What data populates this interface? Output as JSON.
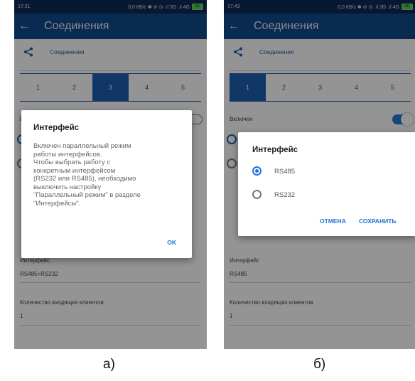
{
  "screen_a": {
    "status": {
      "time": "17:21",
      "indicators": "0,0 КБ/с ✱ ⊘ ◷ .ıl 3G .ıl 4G",
      "battery": "80"
    },
    "appbar": {
      "title": "Соединения"
    },
    "section": {
      "title": "Соединения"
    },
    "tabs": [
      "1",
      "2",
      "3",
      "4",
      "5"
    ],
    "active_tab": "3",
    "fields": {
      "enabled_label": "В",
      "interface_label": "Интерфейс",
      "interface_value": "RS485+RS232",
      "clients_label": "Количество входящих клиентов",
      "clients_value": "1"
    },
    "dialog": {
      "title": "Интерфейс",
      "message": "Включен параллельный режим\nработы интерфейсов.\nЧтобы выбрать работу с\nконкретным интерфейсом\n(RS232 или RS485), необходимо\nвыключить настройку\n\"Параллельный режим\" в разделе\n\"Интерфейсы\".",
      "ok": "OK"
    },
    "caption": "а)"
  },
  "screen_b": {
    "status": {
      "time": "17:43",
      "indicators": "0,0 КБ/с ✱ ⊘ ◷ .ıl 3G .ıl 4G",
      "battery": "80"
    },
    "appbar": {
      "title": "Соединения"
    },
    "section": {
      "title": "Соединения"
    },
    "tabs": [
      "1",
      "2",
      "3",
      "4",
      "5"
    ],
    "active_tab": "1",
    "fields": {
      "enabled_label": "Включен",
      "interface_label": "Интерфейс",
      "interface_value": "RS485",
      "clients_label": "Количество входящих клиентов",
      "clients_value": "1"
    },
    "dialog": {
      "title": "Интерфейс",
      "options": [
        "RS485",
        "RS232"
      ],
      "selected": "RS485",
      "cancel": "ОТМЕНА",
      "save": "СОХРАНИТЬ"
    },
    "caption": "б)"
  },
  "colors": {
    "status_bar": "#0d2a55",
    "app_bar": "#114a8c",
    "accent": "#1c5fb0",
    "dialog_button": "#1c73d6"
  },
  "icons": {
    "back": "arrow-left-icon",
    "share": "share-icon"
  }
}
